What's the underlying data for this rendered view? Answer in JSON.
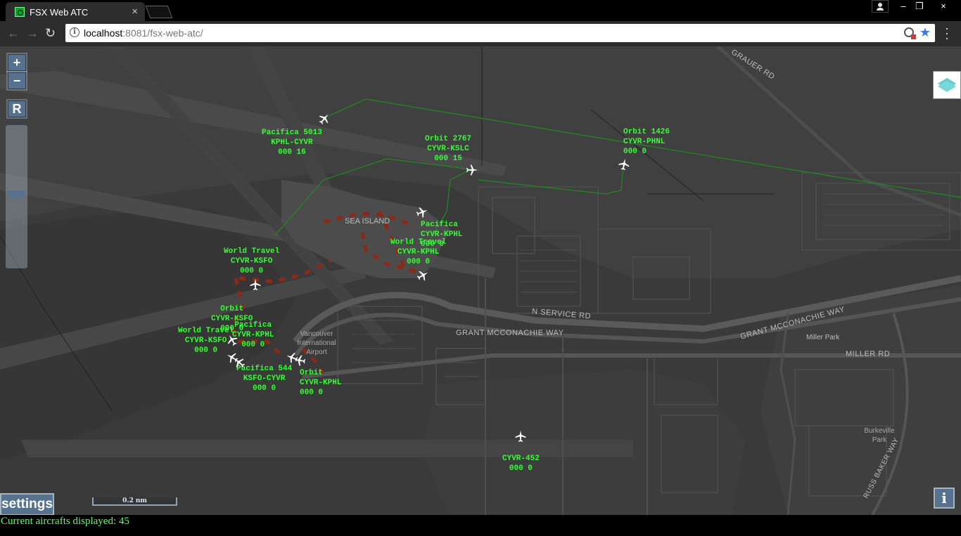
{
  "browser": {
    "tab_title": "FSX Web ATC",
    "tab_close": "×",
    "url_host": "localhost",
    "url_rest": ":8081/fsx-web-atc/",
    "window_controls": [
      "–",
      "❐",
      "×"
    ]
  },
  "map": {
    "zoom_in": "+",
    "zoom_out": "−",
    "reset": "R",
    "zoom_level_fraction": 0.52,
    "scale_text": "0.2 nm",
    "settings_label": "settings",
    "info_label": "i",
    "place_labels": {
      "sea_island": "SEA ISLAND",
      "grauer_rd": "GRAUER RD",
      "n_service_rd": "N SERVICE RD",
      "grant_mcconachie_way_1": "GRANT MCCONACHIE WAY",
      "grant_mcconachie_way_2": "GRANT MCCONACHIE WAY",
      "miller_park": "Miller Park",
      "miller_rd": "MILLER RD",
      "burkeville_park": "Burkeville Park",
      "russ_baker_way": "RUSS BAKER WAY",
      "vancouver_airport": "Vancouver International Airport"
    }
  },
  "aircraft": [
    {
      "callsign": "Pacifica 5013",
      "route": "KPHL-CYVR",
      "alt_speed": "000 16"
    },
    {
      "callsign": "Orbit 2767",
      "route": "CYVR-KSLC",
      "alt_speed": "000 15"
    },
    {
      "callsign": "Orbit 1426",
      "route": "CYVR-PHNL",
      "alt_speed": "000 0"
    },
    {
      "callsign": "Pacifica",
      "route": "CYVR-KPHL",
      "alt_speed": "000 0"
    },
    {
      "callsign": "World Travel",
      "route": "CYVR-KPHL",
      "alt_speed": "000 0"
    },
    {
      "callsign": "World Travel",
      "route": "CYVR-KSFO",
      "alt_speed": "000 0"
    },
    {
      "callsign": "Orbit",
      "route": "CYVR-KSFO",
      "alt_speed": "000 0"
    },
    {
      "callsign": "Pacifica",
      "route": "CYVR-KPHL",
      "alt_speed": "000 0"
    },
    {
      "callsign": "World Travel",
      "route": "CYVR-KSFO",
      "alt_speed": "000 0"
    },
    {
      "callsign": "Pacifica 544",
      "route": "KSFO-CYVR",
      "alt_speed": "000 0"
    },
    {
      "callsign": "Orbit",
      "route": "CYVR-KPHL",
      "alt_speed": "000 0"
    },
    {
      "callsign": "",
      "route": "CYVR-452",
      "alt_speed": "000 0"
    }
  ],
  "status": {
    "text": "Current aircrafts displayed: 45"
  },
  "colors": {
    "map_background": "#3a3a3a",
    "aircraft_label": "#33ff33",
    "flight_path": "#1f8a1f",
    "taxi_path": "#8b2a16",
    "control_button": "#56728f"
  }
}
